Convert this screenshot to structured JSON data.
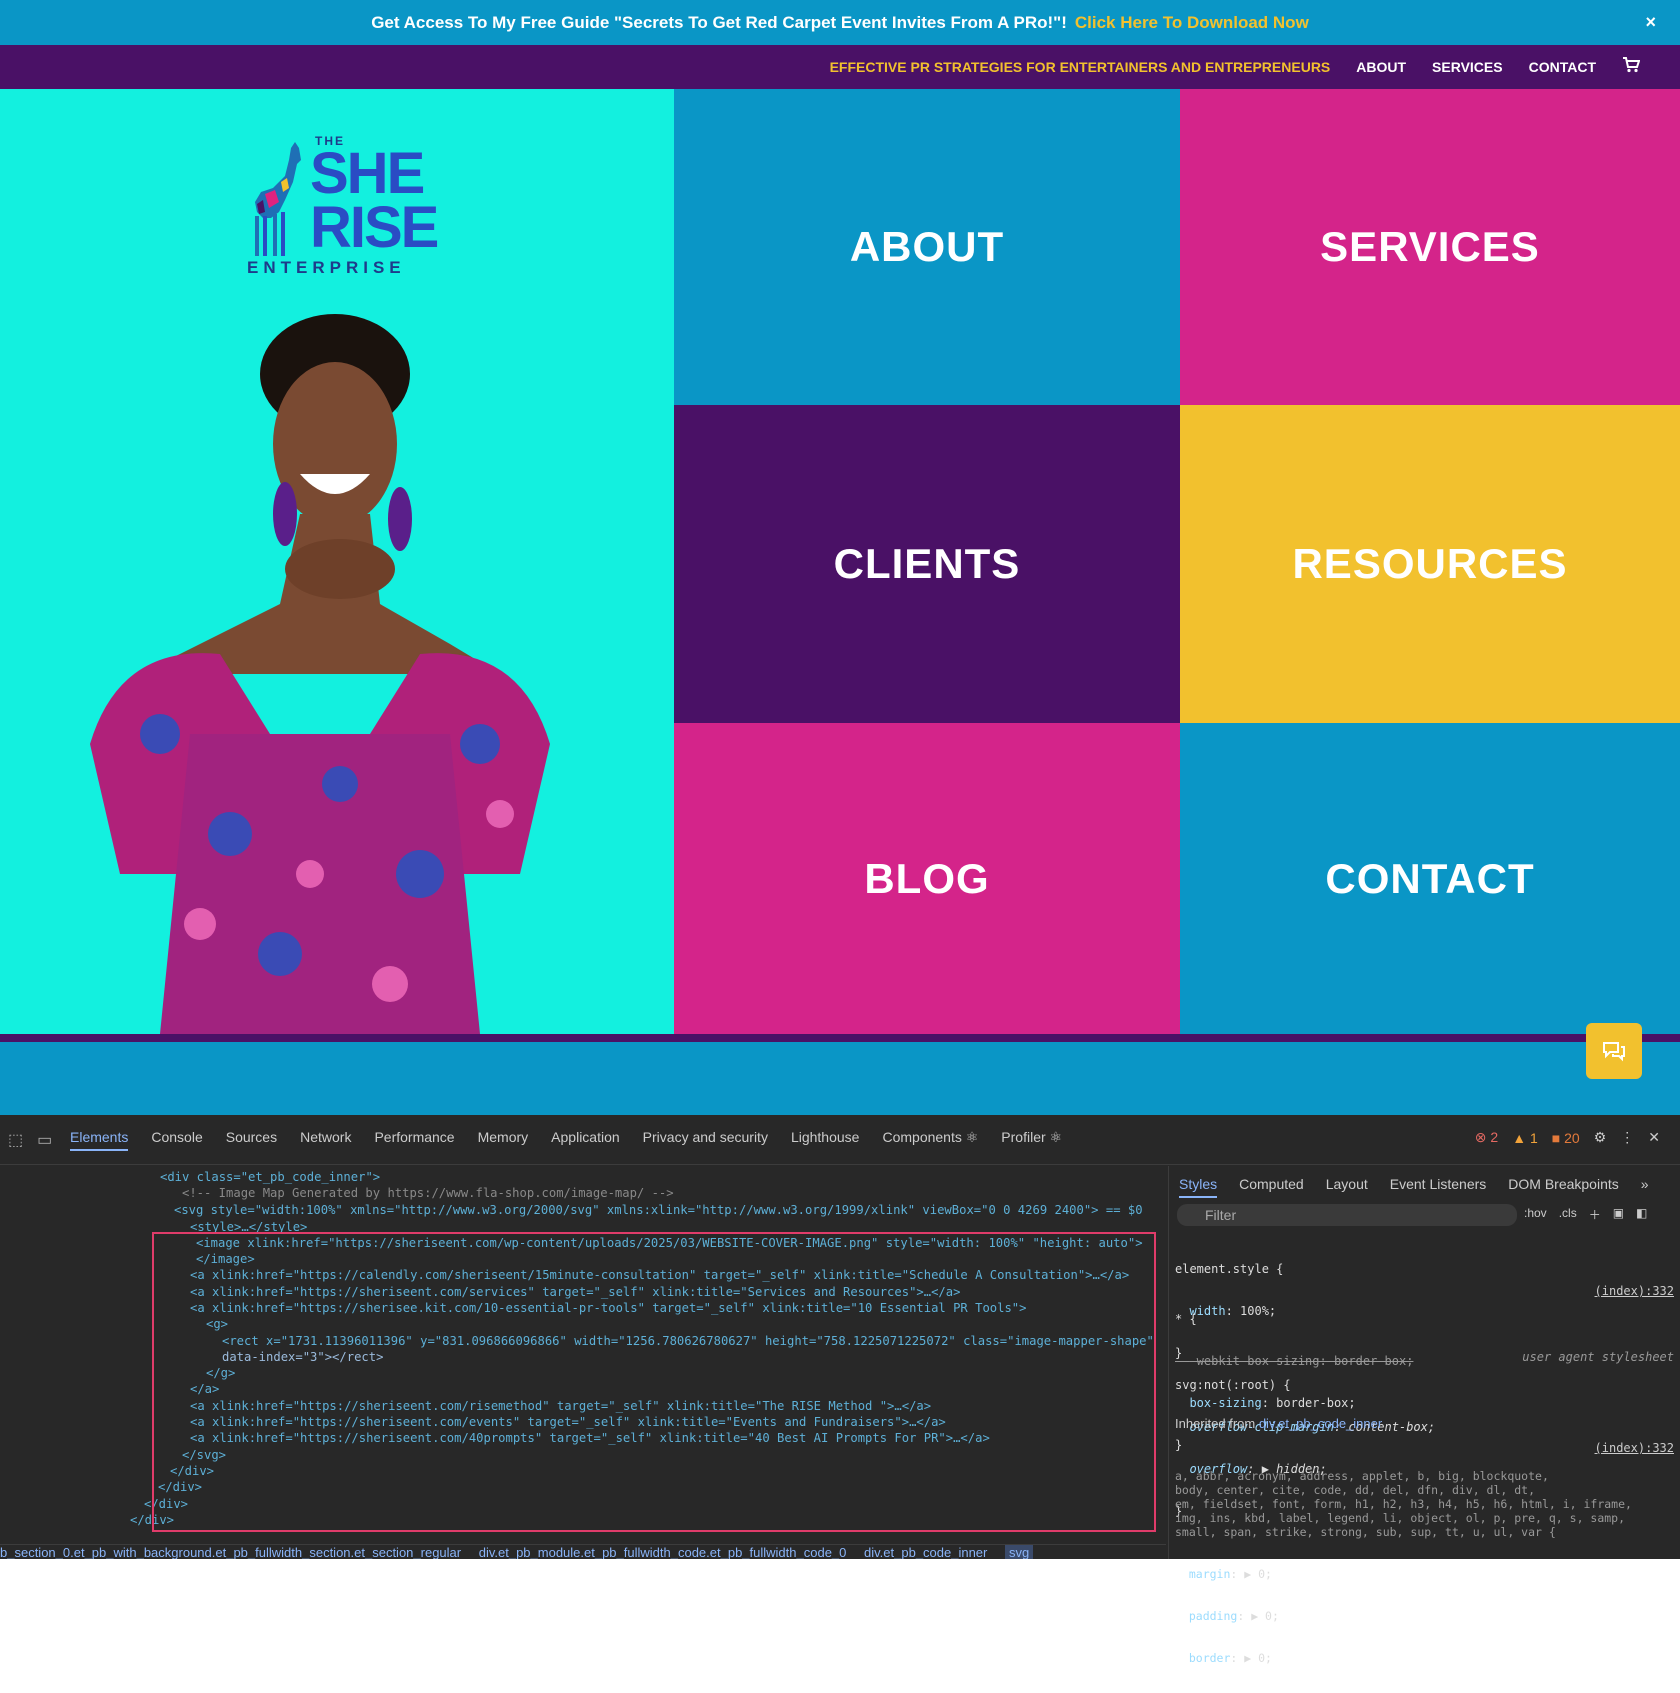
{
  "announcement": {
    "text": "Get Access To My Free Guide \"Secrets To Get Red Carpet Event Invites From A PRo!\"!",
    "link": "Click Here To Download Now",
    "close": "×"
  },
  "nav": {
    "tagline": "EFFECTIVE PR STRATEGIES FOR ENTERTAINERS AND ENTREPRENEURS",
    "items": [
      "ABOUT",
      "SERVICES",
      "CONTACT"
    ],
    "cart_icon": "shopping-cart-icon"
  },
  "logo": {
    "the": "THE",
    "she": "SHE",
    "rise": "RISE",
    "enterprise": "ENTERPRISE"
  },
  "tiles": [
    {
      "label": "ABOUT",
      "color": "#0a96c6"
    },
    {
      "label": "SERVICES",
      "color": "#d4248a"
    },
    {
      "label": "CLIENTS",
      "color": "#4a1166"
    },
    {
      "label": "RESOURCES",
      "color": "#f2c12e"
    },
    {
      "label": "BLOG",
      "color": "#d4248a"
    },
    {
      "label": "CONTACT",
      "color": "#0a96c6"
    }
  ],
  "devtools": {
    "tabs": [
      "Elements",
      "Console",
      "Sources",
      "Network",
      "Performance",
      "Memory",
      "Application",
      "Privacy and security",
      "Lighthouse",
      "Components ⚛",
      "Profiler ⚛"
    ],
    "errors": "2",
    "warnings": "1",
    "issues": "20",
    "code": [
      "<div class=\"et_pb_code_inner\">",
      "<!-- Image Map Generated by https://www.fla-shop.com/image-map/ -->",
      "<svg style=\"width:100%\" xmlns=\"http://www.w3.org/2000/svg\" xmlns:xlink=\"http://www.w3.org/1999/xlink\" viewBox=\"0 0 4269 2400\"> == $0",
      "<style>…</style>",
      "<image xlink:href=\"https://sheriseent.com/wp-content/uploads/2025/03/WEBSITE-COVER-IMAGE.png\" style=\"width: 100%\" \"height: auto\">",
      "</image>",
      "<a xlink:href=\"https://calendly.com/sheriseent/15minute-consultation\" target=\"_self\" xlink:title=\"Schedule A Consultation\">…</a>",
      "<a xlink:href=\"https://sheriseent.com/services\" target=\"_self\" xlink:title=\"Services and Resources\">…</a>",
      "<a xlink:href=\"https://sherisee.kit.com/10-essential-pr-tools\" target=\"_self\" xlink:title=\"10 Essential PR Tools\">",
      "<g>",
      "<rect x=\"1731.11396011396\" y=\"831.096866096866\" width=\"1256.780626780627\" height=\"758.1225071225072\" class=\"image-mapper-shape\"",
      "data-index=\"3\"></rect>",
      "</g>",
      "</a>",
      "<a xlink:href=\"https://sheriseent.com/risemethod\" target=\"_self\" xlink:title=\"The RISE Method \">…</a>",
      "<a xlink:href=\"https://sheriseent.com/events\" target=\"_self\" xlink:title=\"Events and Fundraisers\">…</a>",
      "<a xlink:href=\"https://sheriseent.com/40prompts\" target=\"_self\" xlink:title=\"40 Best AI Prompts For PR\">…</a>",
      "</svg>",
      "</div>",
      "</div>",
      "</div>",
      "</div>"
    ],
    "styles_tabs": [
      "Styles",
      "Computed",
      "Layout",
      "Event Listeners",
      "DOM Breakpoints",
      "»"
    ],
    "filter_placeholder": "Filter",
    "hov": ":hov",
    "cls": ".cls",
    "rules": {
      "element_style": "element.style {",
      "element_prop": "width",
      "element_val": "100%;",
      "star_sel": "* {",
      "star_src": "(index):332",
      "star_strike": "-webkit-box-sizing: border-box;",
      "star_prop": "box-sizing",
      "star_val": "border-box;",
      "svg_sel": "svg:not(:root) {",
      "svg_src": "user agent stylesheet",
      "svg_p1": "overflow-clip-margin",
      "svg_v1": "content-box;",
      "svg_p2": "overflow",
      "svg_v2": "▶ hidden;",
      "inherited": "Inherited from",
      "inherited_el": "div.et_pb_code_inner",
      "inh_src": "(index):332",
      "inh_sel": "a, abbr, acronym, address, applet, b, big, blockquote,\nbody, center, cite, code, dd, del, dfn, div, dl, dt,\nem, fieldset, font, form, h1, h2, h3, h4, h5, h6, html, i, iframe,\nimg, ins, kbd, label, legend, li, object, ol, p, pre, q, s, samp,\nsmall, span, strike, strong, sub, sup, tt, u, ul, var {",
      "inh_p1": "margin",
      "inh_p2": "padding",
      "inh_p3": "border",
      "inh_v": "▶ 0;"
    },
    "breadcrumbs": [
      "b_section_0.et_pb_with_background.et_pb_fullwidth_section.et_section_regular",
      "div.et_pb_module.et_pb_fullwidth_code.et_pb_fullwidth_code_0",
      "div.et_pb_code_inner",
      "svg"
    ]
  }
}
